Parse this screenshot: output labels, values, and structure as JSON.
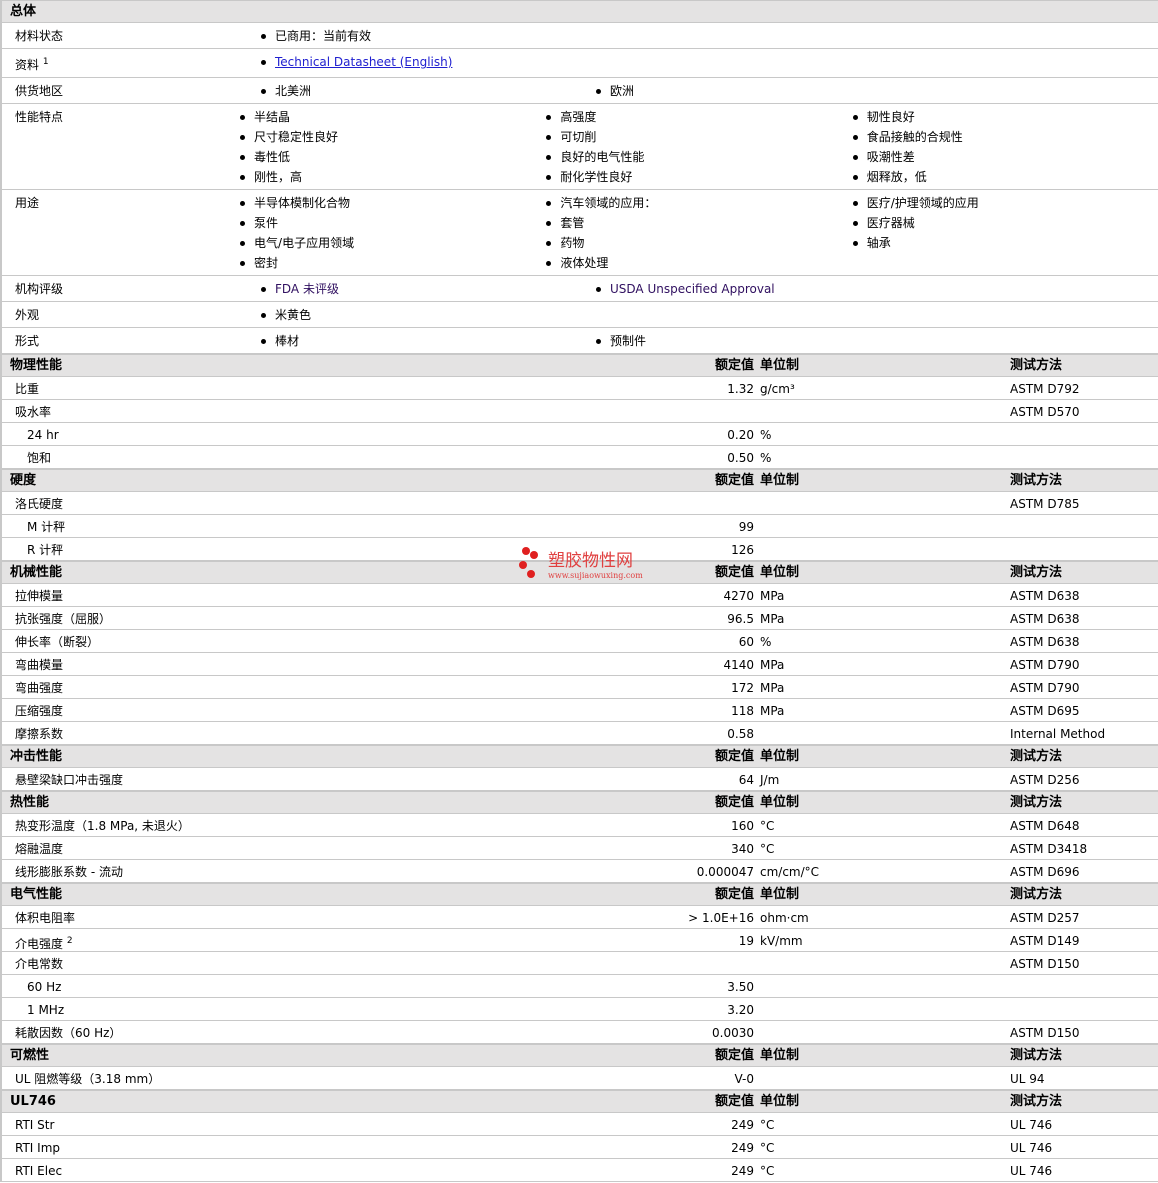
{
  "general": {
    "title": "总体",
    "rows": [
      {
        "label": "材料状态",
        "cols": [
          [
            "已商用：当前有效"
          ]
        ]
      },
      {
        "label": "资料",
        "sup": "1",
        "cols": [
          [
            "Technical Datasheet (English)"
          ]
        ],
        "link": true
      },
      {
        "label": "供货地区",
        "cols": [
          [
            "北美洲"
          ],
          [
            "欧洲"
          ]
        ]
      },
      {
        "label": "性能特点",
        "cols": [
          [
            "半结晶",
            "尺寸稳定性良好",
            "毒性低",
            "刚性，高"
          ],
          [
            "高强度",
            "可切削",
            "良好的电气性能",
            "耐化学性良好"
          ],
          [
            "韧性良好",
            "食品接触的合规性",
            "吸潮性差",
            "烟释放，低"
          ]
        ]
      },
      {
        "label": "用途",
        "cols": [
          [
            "半导体模制化合物",
            "泵件",
            "电气/电子应用领域",
            "密封"
          ],
          [
            "汽车领域的应用：",
            "套管",
            "药物",
            "液体处理"
          ],
          [
            "医疗/护理领域的应用",
            "医疗器械",
            "轴承"
          ]
        ]
      },
      {
        "label": "机构评级",
        "cols": [
          [
            "FDA 未评级"
          ],
          [
            "USDA Unspecified Approval"
          ]
        ]
      },
      {
        "label": "外观",
        "cols": [
          [
            "米黄色"
          ]
        ]
      },
      {
        "label": "形式",
        "cols": [
          [
            "棒材"
          ],
          [
            "预制件"
          ]
        ]
      }
    ]
  },
  "headers": {
    "value": "额定值",
    "unit": "单位制",
    "method": "测试方法"
  },
  "sections": [
    {
      "title": "物理性能",
      "rows": [
        {
          "label": "比重",
          "value": "1.32",
          "unit": "g/cm³",
          "method": "ASTM D792"
        },
        {
          "label": "吸水率",
          "value": "",
          "unit": "",
          "method": "ASTM D570"
        },
        {
          "label": "24 hr",
          "sub": true,
          "value": "0.20",
          "unit": "%",
          "method": ""
        },
        {
          "label": "饱和",
          "sub": true,
          "value": "0.50",
          "unit": "%",
          "method": ""
        }
      ]
    },
    {
      "title": "硬度",
      "rows": [
        {
          "label": "洛氏硬度",
          "value": "",
          "unit": "",
          "method": "ASTM D785"
        },
        {
          "label": "M 计秤",
          "sub": true,
          "value": "99",
          "unit": "",
          "method": ""
        },
        {
          "label": "R 计秤",
          "sub": true,
          "value": "126",
          "unit": "",
          "method": ""
        }
      ]
    },
    {
      "title": "机械性能",
      "rows": [
        {
          "label": "拉伸模量",
          "value": "4270",
          "unit": "MPa",
          "method": "ASTM D638"
        },
        {
          "label": "抗张强度（屈服）",
          "value": "96.5",
          "unit": "MPa",
          "method": "ASTM D638"
        },
        {
          "label": "伸长率（断裂）",
          "value": "60",
          "unit": "%",
          "method": "ASTM D638"
        },
        {
          "label": "弯曲模量",
          "value": "4140",
          "unit": "MPa",
          "method": "ASTM D790"
        },
        {
          "label": "弯曲强度",
          "value": "172",
          "unit": "MPa",
          "method": "ASTM D790"
        },
        {
          "label": "压缩强度",
          "value": "118",
          "unit": "MPa",
          "method": "ASTM D695"
        },
        {
          "label": "摩擦系数",
          "value": "0.58",
          "unit": "",
          "method": "Internal Method"
        }
      ]
    },
    {
      "title": "冲击性能",
      "rows": [
        {
          "label": "悬壁梁缺口冲击强度",
          "value": "64",
          "unit": "J/m",
          "method": "ASTM D256"
        }
      ]
    },
    {
      "title": "热性能",
      "rows": [
        {
          "label": "热变形温度（1.8 MPa, 未退火）",
          "value": "160",
          "unit": "°C",
          "method": "ASTM D648"
        },
        {
          "label": "熔融温度",
          "value": "340",
          "unit": "°C",
          "method": "ASTM D3418"
        },
        {
          "label": "线形膨胀系数 - 流动",
          "value": "0.000047",
          "unit": "cm/cm/°C",
          "method": "ASTM D696"
        }
      ]
    },
    {
      "title": "电气性能",
      "rows": [
        {
          "label": "体积电阻率",
          "value": "> 1.0E+16",
          "unit": "ohm·cm",
          "method": "ASTM D257"
        },
        {
          "label": "介电强度",
          "sup": "2",
          "value": "19",
          "unit": "kV/mm",
          "method": "ASTM D149"
        },
        {
          "label": "介电常数",
          "value": "",
          "unit": "",
          "method": "ASTM D150"
        },
        {
          "label": "60 Hz",
          "sub": true,
          "value": "3.50",
          "unit": "",
          "method": ""
        },
        {
          "label": "1 MHz",
          "sub": true,
          "value": "3.20",
          "unit": "",
          "method": ""
        },
        {
          "label": "耗散因数（60 Hz）",
          "value": "0.0030",
          "unit": "",
          "method": "ASTM D150"
        }
      ]
    },
    {
      "title": "可燃性",
      "rows": [
        {
          "label": "UL 阻燃等级（3.18 mm）",
          "value": "V-0",
          "unit": "",
          "method": "UL 94"
        }
      ]
    },
    {
      "title": "UL746",
      "rows": [
        {
          "label": "RTI Str",
          "value": "249",
          "unit": "°C",
          "method": "UL 746"
        },
        {
          "label": "RTI Imp",
          "value": "249",
          "unit": "°C",
          "method": "UL 746"
        },
        {
          "label": "RTI Elec",
          "value": "249",
          "unit": "°C",
          "method": "UL 746"
        }
      ]
    }
  ],
  "watermark": {
    "name": "塑胶物性网",
    "url": "www.sujiaowuxing.com",
    "color": "#e02020"
  }
}
